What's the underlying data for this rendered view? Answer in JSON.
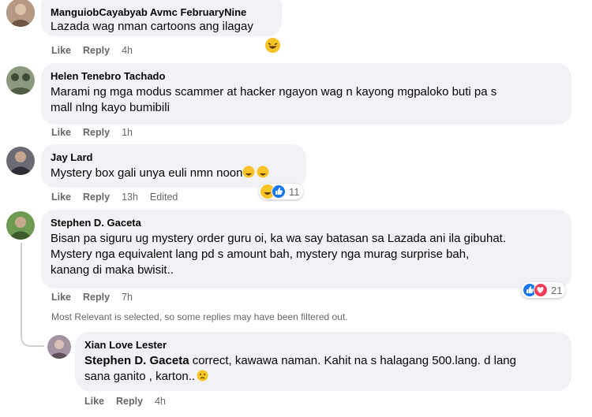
{
  "comments": [
    {
      "author": "ManguiobCayabyab Avmc FebruaryNine",
      "text": "Lazada wag nman cartoons ang ilagay",
      "like": "Like",
      "reply": "Reply",
      "time": "4h",
      "avatar_color": "#8a7060"
    },
    {
      "author": "Helen Tenebro Tachado",
      "text_line1": "Marami ng mga modus scammer at hacker ngayon wag n kayong mgpaloko buti pa s",
      "text_line2": "mall nlng kayo bumibili",
      "like": "Like",
      "reply": "Reply",
      "time": "1h",
      "avatar_color": "#5a6b4e"
    },
    {
      "author": "Jay Lard",
      "text": "Mystery box gali unya euli nmn noon",
      "like": "Like",
      "reply": "Reply",
      "time": "13h",
      "edited": "Edited",
      "reaction_count": "11",
      "avatar_color": "#3f3f46"
    },
    {
      "author": "Stephen D. Gaceta",
      "text_line1": "Bisan pa siguru ug mystery order guru oi, ka wa say batasan sa Lazada ani ila gibuhat.",
      "text_line2": "Mystery nga equivalent lang pd s amount bah, mystery nga murag surprise bah,",
      "text_line3": "kanang di maka bwisit..",
      "like": "Like",
      "reply": "Reply",
      "time": "7h",
      "reaction_count": "21",
      "avatar_color": "#4f7a3a"
    }
  ],
  "filter_note": "Most Relevant is selected, so some replies may have been filtered out.",
  "reply": {
    "author": "Xian Love Lester",
    "mention": "Stephen D. Gaceta",
    "text_line1_rest": " correct, kawawa naman. Kahit na s halagang 500.lang. d lang",
    "text_line2": "sana ganito , karton..",
    "like": "Like",
    "reply": "Reply",
    "time": "4h",
    "avatar_color": "#7a6a72"
  },
  "colors": {
    "bubble": "#f0f2f5",
    "meta_text": "#65676b",
    "like_blue": "#1877f2",
    "love_red": "#f33e58",
    "haha_yellow": "#f7b125"
  }
}
